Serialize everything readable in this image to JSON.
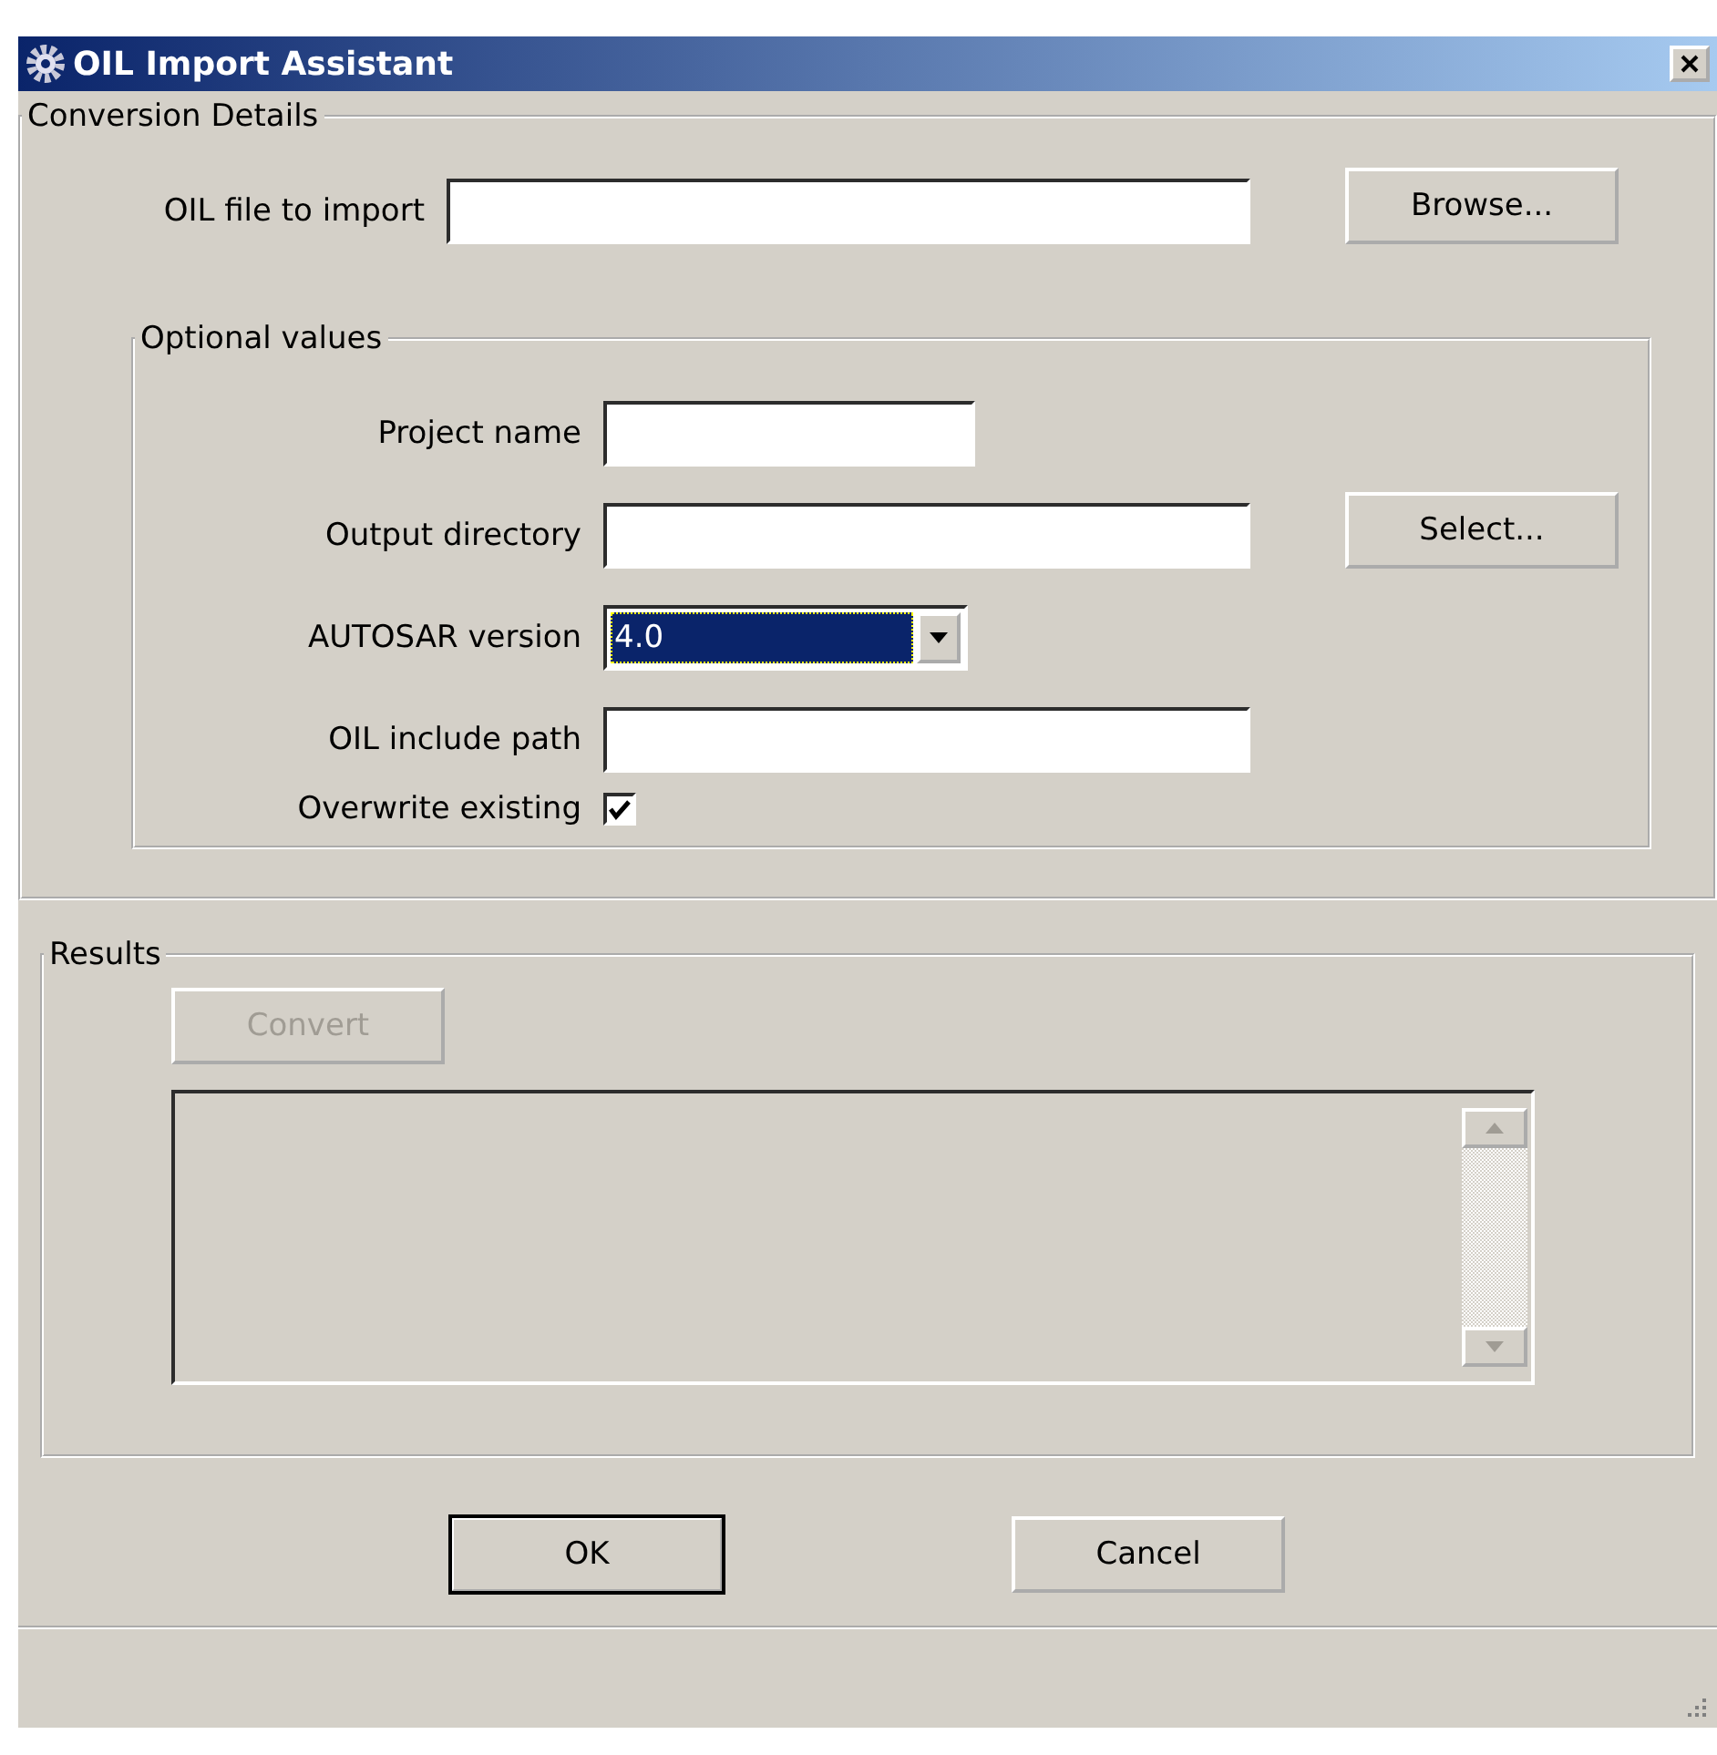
{
  "window": {
    "title": "OIL Import Assistant"
  },
  "conversion_details": {
    "legend": "Conversion Details",
    "oil_file": {
      "label": "OIL file to import"
    },
    "browse_button": "Browse...",
    "optional_values": {
      "legend": "Optional values",
      "rows": [
        {
          "kind": "short_text",
          "label": "Project name"
        },
        {
          "kind": "text",
          "label": "Output directory",
          "button": "Select..."
        },
        {
          "kind": "select",
          "label": "AUTOSAR version",
          "value": "4.0"
        },
        {
          "kind": "text",
          "label": "OIL include path"
        },
        {
          "kind": "checkbox",
          "label": "Overwrite existing",
          "checked": true
        }
      ]
    }
  },
  "results": {
    "legend": "Results",
    "convert_button": {
      "label": "Convert",
      "disabled": true
    }
  },
  "buttons": [
    {
      "label": "OK",
      "default": true
    },
    {
      "label": "Cancel",
      "default": false
    }
  ]
}
